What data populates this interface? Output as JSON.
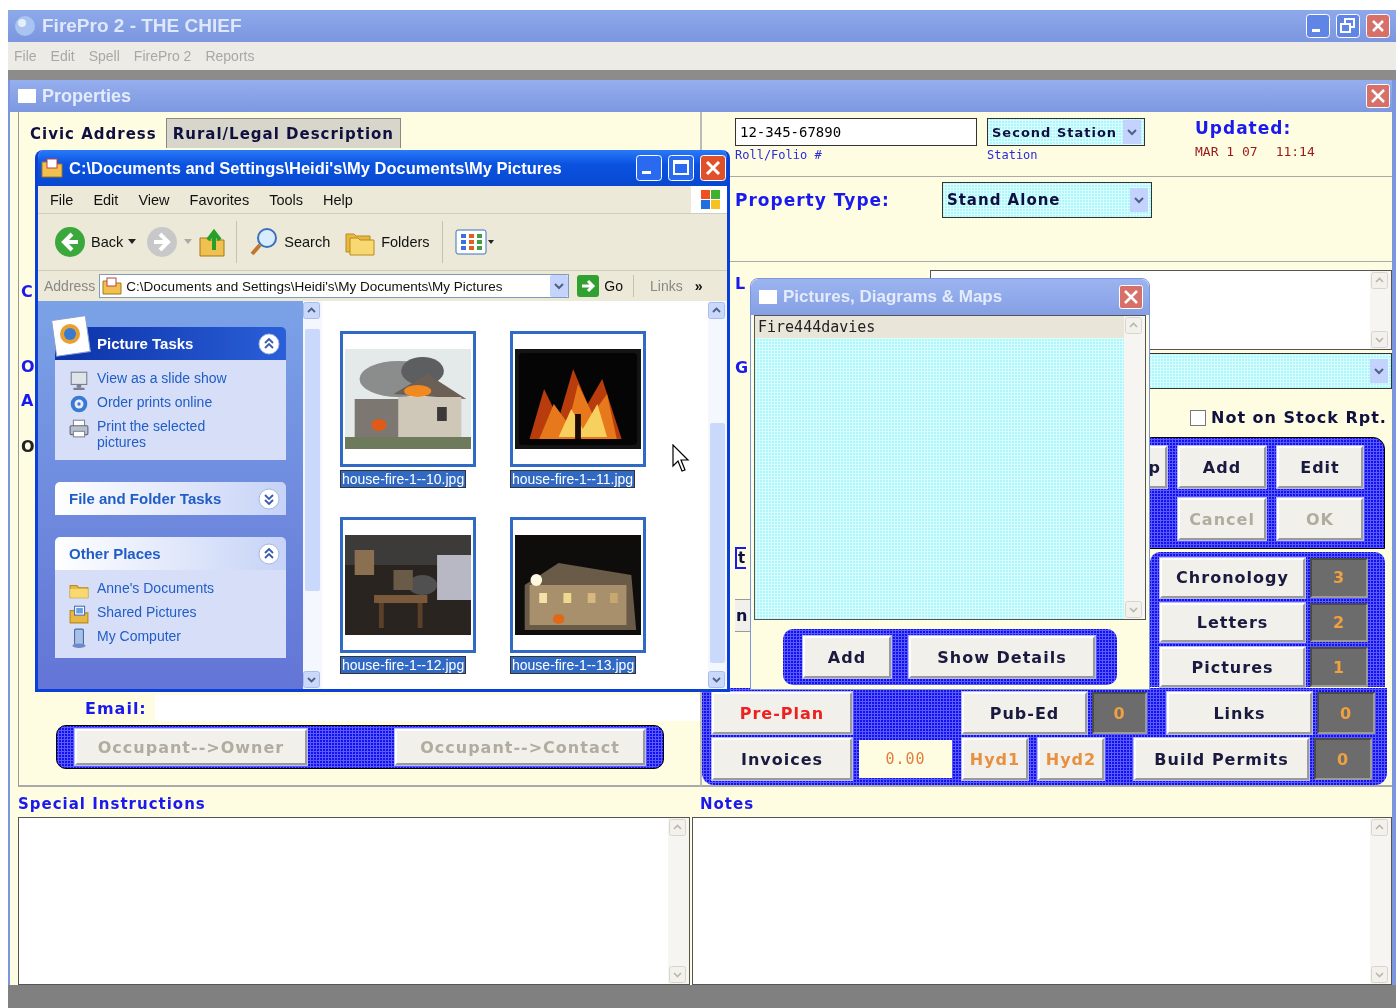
{
  "app_window": {
    "title": "FirePro 2 - THE CHIEF",
    "menu": [
      "File",
      "Edit",
      "Spell",
      "FirePro 2",
      "Reports"
    ]
  },
  "properties": {
    "title": "Properties",
    "tabs": [
      {
        "label": "Civic Address",
        "selected": true
      },
      {
        "label": "Rural/Legal Description",
        "selected": false
      }
    ],
    "covered_labels_left": [
      {
        "text": "C",
        "kind": "label"
      },
      {
        "text": "O",
        "kind": "label"
      },
      {
        "text": "A",
        "kind": "label"
      },
      {
        "text": "O",
        "kind": "text"
      }
    ],
    "email": {
      "label": "Email:"
    },
    "occupant_buttons": [
      {
        "label": "Occupant-->Owner",
        "disabled": true
      },
      {
        "label": "Occupant-->Contact",
        "disabled": true
      }
    ],
    "roll_folio": {
      "value": "12-345-67890",
      "label": "Roll/Folio #"
    },
    "station": {
      "value": "Second Station",
      "label": "Station"
    },
    "updated": {
      "label": "Updated:",
      "date": "MAR 1 07",
      "time": "11:14"
    },
    "property_type": {
      "label": "Property Type:",
      "value": "Stand Alone"
    },
    "covered_labels_right": [
      {
        "text": "L",
        "kind": "label"
      },
      {
        "text": "G",
        "kind": "label"
      },
      {
        "text": "t",
        "kind": "field"
      },
      {
        "text": "n",
        "kind": "button"
      }
    ],
    "not_on_stock": {
      "label": "Not on Stock Rpt.",
      "checked": false
    },
    "record_buttons": [
      {
        "label": "p",
        "disabled": false
      },
      {
        "label": "Add",
        "disabled": false
      },
      {
        "label": "Edit",
        "disabled": false
      },
      {
        "label": "Cancel",
        "disabled": true
      },
      {
        "label": "OK",
        "disabled": true
      }
    ],
    "counters": [
      {
        "label": "Chronology",
        "count": "3"
      },
      {
        "label": "Letters",
        "count": "2"
      },
      {
        "label": "Pictures",
        "count": "1"
      }
    ],
    "bottom_panel": {
      "pre_plan": "Pre-Plan",
      "pub_ed": {
        "label": "Pub-Ed",
        "count": "0"
      },
      "links": {
        "label": "Links",
        "count": "0"
      },
      "invoices": {
        "label": "Invoices",
        "amount": "0.00"
      },
      "hydrants": [
        "Hyd1",
        "Hyd2"
      ],
      "build_permits": {
        "label": "Build Permits",
        "count": "0"
      }
    },
    "special_instructions": {
      "label": "Special Instructions"
    },
    "notes": {
      "label": "Notes"
    }
  },
  "explorer_window": {
    "title": "C:\\Documents and Settings\\Heidi's\\My Documents\\My Pictures",
    "menu": [
      "File",
      "Edit",
      "View",
      "Favorites",
      "Tools",
      "Help"
    ],
    "toolbar": {
      "back": "Back",
      "search": "Search",
      "folders": "Folders"
    },
    "address": {
      "label": "Address",
      "value": "C:\\Documents and Settings\\Heidi's\\My Documents\\My Pictures",
      "go": "Go",
      "links": "Links",
      "more": "»"
    },
    "task_panels": [
      {
        "title": "Picture Tasks",
        "kind": "special",
        "expanded": true,
        "items": [
          "View as a slide show",
          "Order prints online",
          "Print the selected pictures"
        ]
      },
      {
        "title": "File and Folder Tasks",
        "kind": "normal",
        "expanded": false
      },
      {
        "title": "Other Places",
        "kind": "normal",
        "expanded": true,
        "items": [
          "Anne's Documents",
          "Shared Pictures",
          "My Computer"
        ]
      }
    ],
    "files": [
      {
        "name": "house-fire-1--10.jpg",
        "selected": true
      },
      {
        "name": "house-fire-1--11.jpg",
        "selected": true
      },
      {
        "name": "house-fire-1--12.jpg",
        "selected": true
      },
      {
        "name": "house-fire-1--13.jpg",
        "selected": true
      }
    ]
  },
  "pictures_dialog": {
    "title": "Pictures, Diagrams & Maps",
    "items": [
      "Fire444davies"
    ],
    "buttons": [
      "Add",
      "Show Details"
    ]
  }
}
